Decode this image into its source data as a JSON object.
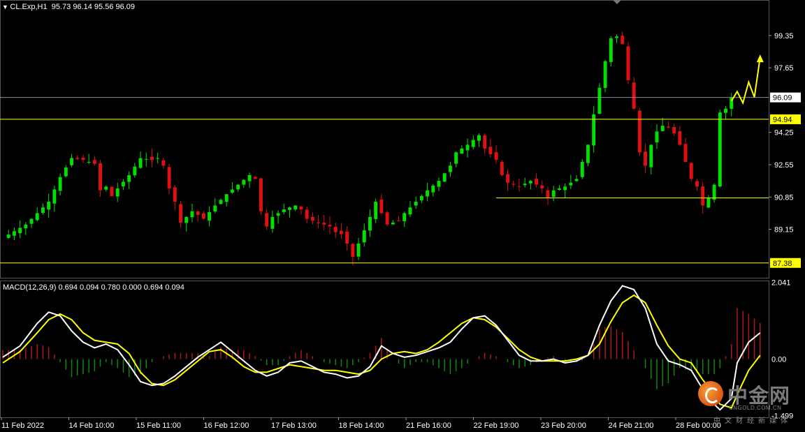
{
  "header": {
    "symbol": "CL.Exp,H1",
    "ohlc": "95.73 96.14 95.56 96.09",
    "macd_label": "MACD(12,26,9) 0.694 0.094 0.780 0.000 0.694 0.094"
  },
  "colors": {
    "background": "#000000",
    "bull": "#00e000",
    "bear": "#e01010",
    "level_line": "#ffff00",
    "bid_line": "#8a8ea8",
    "macd_line": "#ffffff",
    "signal_line": "#ffff00",
    "axis_text": "#ffffff"
  },
  "chart_data": [
    {
      "type": "candlestick",
      "title": "CL.Exp,H1",
      "y_ticks": [
        "99.35",
        "97.65",
        "94.25",
        "92.55",
        "90.85",
        "89.15"
      ],
      "ylim": [
        86.6,
        100.85
      ],
      "x_ticks": [
        "11 Feb 2022",
        "14 Feb 10:00",
        "15 Feb 11:00",
        "16 Feb 12:00",
        "17 Feb 13:00",
        "18 Feb 14:00",
        "21 Feb 16:00",
        "22 Feb 19:00",
        "23 Feb 20:00",
        "24 Feb 21:00",
        "28 Feb 00:00"
      ],
      "levels": [
        {
          "label": "96.09",
          "value": 96.09,
          "kind": "bid"
        },
        {
          "label": "94.94",
          "value": 94.94,
          "kind": "horizontal"
        },
        {
          "label": "87.38",
          "value": 87.38,
          "kind": "horizontal"
        }
      ],
      "support_segment": {
        "value": 90.8
      },
      "close_path": [
        [
          0,
          88.7
        ],
        [
          4,
          89.4
        ],
        [
          8,
          90.6
        ],
        [
          10,
          91.9
        ],
        [
          12,
          92.9
        ],
        [
          14,
          92.8
        ],
        [
          16,
          92.6
        ],
        [
          17,
          91.2
        ],
        [
          18,
          91.4
        ],
        [
          19,
          90.9
        ],
        [
          20,
          91.3
        ],
        [
          22,
          92.0
        ],
        [
          24,
          92.9
        ],
        [
          26,
          92.8
        ],
        [
          27,
          92.9
        ],
        [
          28,
          92.5
        ],
        [
          29,
          91.3
        ],
        [
          30,
          90.6
        ],
        [
          31,
          89.5
        ],
        [
          32,
          89.8
        ],
        [
          33,
          90.1
        ],
        [
          35,
          89.7
        ],
        [
          37,
          90.4
        ],
        [
          39,
          91.0
        ],
        [
          41,
          91.5
        ],
        [
          43,
          92.0
        ],
        [
          44,
          91.8
        ],
        [
          45,
          90.1
        ],
        [
          46,
          89.3
        ],
        [
          47,
          89.8
        ],
        [
          49,
          90.2
        ],
        [
          51,
          90.4
        ],
        [
          52,
          90.2
        ],
        [
          53,
          89.7
        ],
        [
          55,
          89.5
        ],
        [
          57,
          89.3
        ],
        [
          58,
          89.0
        ],
        [
          59,
          88.9
        ],
        [
          60,
          88.4
        ],
        [
          61,
          87.7
        ],
        [
          62,
          88.4
        ],
        [
          63,
          89.1
        ],
        [
          64,
          89.8
        ],
        [
          65,
          90.6
        ],
        [
          66,
          90.0
        ],
        [
          67,
          89.4
        ],
        [
          69,
          89.6
        ],
        [
          70,
          90.0
        ],
        [
          72,
          90.6
        ],
        [
          74,
          91.2
        ],
        [
          76,
          91.7
        ],
        [
          78,
          92.5
        ],
        [
          79,
          93.2
        ],
        [
          81,
          93.6
        ],
        [
          83,
          94.1
        ],
        [
          84,
          93.4
        ],
        [
          86,
          92.8
        ],
        [
          87,
          92.0
        ],
        [
          88,
          91.6
        ],
        [
          90,
          91.4
        ],
        [
          92,
          91.7
        ],
        [
          94,
          91.3
        ],
        [
          95,
          90.8
        ],
        [
          96,
          91.2
        ],
        [
          98,
          91.4
        ],
        [
          100,
          91.8
        ],
        [
          101,
          92.7
        ],
        [
          102,
          93.6
        ],
        [
          103,
          95.2
        ],
        [
          104,
          96.6
        ],
        [
          105,
          98.0
        ],
        [
          106,
          99.2
        ],
        [
          107,
          99.3
        ],
        [
          108,
          98.9
        ],
        [
          109,
          97.0
        ],
        [
          110,
          95.5
        ],
        [
          111,
          93.2
        ],
        [
          112,
          92.5
        ],
        [
          113,
          93.6
        ],
        [
          114,
          94.3
        ],
        [
          115,
          94.6
        ],
        [
          116,
          94.5
        ],
        [
          117,
          94.2
        ],
        [
          118,
          93.6
        ],
        [
          119,
          92.7
        ],
        [
          120,
          91.8
        ],
        [
          121,
          91.4
        ],
        [
          122,
          90.4
        ],
        [
          123,
          90.8
        ],
        [
          124,
          91.5
        ],
        [
          125,
          95.3
        ],
        [
          126,
          95.5
        ],
        [
          127,
          96.09
        ]
      ],
      "projection_arrow": [
        [
          127,
          95.9
        ],
        [
          128,
          96.4
        ],
        [
          129,
          95.8
        ],
        [
          130,
          96.9
        ],
        [
          131,
          96.1
        ],
        [
          132,
          98.2
        ]
      ]
    },
    {
      "type": "line",
      "title": "MACD(12,26,9) 0.694 0.094 0.780 0.000 0.694 0.094",
      "y_ticks": [
        "2.041",
        "0.00",
        "-1.499"
      ],
      "ylim": [
        -1.55,
        2.09
      ],
      "series": [
        {
          "name": "MACD",
          "points": [
            [
              0,
              0.05
            ],
            [
              3,
              0.35
            ],
            [
              6,
              0.95
            ],
            [
              8,
              1.25
            ],
            [
              10,
              1.15
            ],
            [
              12,
              0.75
            ],
            [
              14,
              0.45
            ],
            [
              16,
              0.3
            ],
            [
              18,
              0.4
            ],
            [
              20,
              0.25
            ],
            [
              22,
              -0.15
            ],
            [
              24,
              -0.6
            ],
            [
              26,
              -0.7
            ],
            [
              28,
              -0.65
            ],
            [
              30,
              -0.45
            ],
            [
              32,
              -0.2
            ],
            [
              34,
              0.05
            ],
            [
              36,
              0.25
            ],
            [
              38,
              0.45
            ],
            [
              40,
              0.2
            ],
            [
              42,
              -0.05
            ],
            [
              44,
              -0.3
            ],
            [
              46,
              -0.45
            ],
            [
              48,
              -0.35
            ],
            [
              50,
              -0.1
            ],
            [
              52,
              -0.05
            ],
            [
              54,
              -0.2
            ],
            [
              56,
              -0.35
            ],
            [
              58,
              -0.4
            ],
            [
              60,
              -0.5
            ],
            [
              62,
              -0.45
            ],
            [
              64,
              -0.2
            ],
            [
              66,
              0.35
            ],
            [
              68,
              0.15
            ],
            [
              70,
              0.05
            ],
            [
              72,
              0.1
            ],
            [
              74,
              0.2
            ],
            [
              76,
              0.3
            ],
            [
              78,
              0.45
            ],
            [
              80,
              0.8
            ],
            [
              82,
              1.1
            ],
            [
              84,
              1.15
            ],
            [
              86,
              0.9
            ],
            [
              88,
              0.5
            ],
            [
              90,
              0.1
            ],
            [
              92,
              -0.05
            ],
            [
              94,
              -0.05
            ],
            [
              96,
              0.0
            ],
            [
              98,
              -0.1
            ],
            [
              100,
              -0.05
            ],
            [
              102,
              0.1
            ],
            [
              104,
              0.9
            ],
            [
              106,
              1.55
            ],
            [
              108,
              1.95
            ],
            [
              110,
              1.85
            ],
            [
              112,
              1.35
            ],
            [
              114,
              0.4
            ],
            [
              116,
              -0.05
            ],
            [
              118,
              -0.15
            ],
            [
              120,
              -0.3
            ],
            [
              122,
              -0.8
            ],
            [
              124,
              -1.2
            ],
            [
              125,
              -1.35
            ],
            [
              127,
              -1.05
            ],
            [
              128,
              -0.1
            ],
            [
              130,
              0.45
            ],
            [
              132,
              0.7
            ]
          ]
        },
        {
          "name": "Signal",
          "points": [
            [
              0,
              -0.1
            ],
            [
              3,
              0.2
            ],
            [
              6,
              0.7
            ],
            [
              8,
              1.05
            ],
            [
              10,
              1.2
            ],
            [
              12,
              1.05
            ],
            [
              14,
              0.7
            ],
            [
              16,
              0.5
            ],
            [
              18,
              0.45
            ],
            [
              20,
              0.4
            ],
            [
              22,
              0.15
            ],
            [
              24,
              -0.35
            ],
            [
              26,
              -0.65
            ],
            [
              28,
              -0.7
            ],
            [
              30,
              -0.55
            ],
            [
              32,
              -0.3
            ],
            [
              34,
              -0.05
            ],
            [
              36,
              0.2
            ],
            [
              38,
              0.25
            ],
            [
              40,
              0.05
            ],
            [
              42,
              -0.2
            ],
            [
              44,
              -0.35
            ],
            [
              46,
              -0.35
            ],
            [
              48,
              -0.25
            ],
            [
              50,
              -0.15
            ],
            [
              52,
              -0.2
            ],
            [
              54,
              -0.25
            ],
            [
              56,
              -0.3
            ],
            [
              58,
              -0.3
            ],
            [
              60,
              -0.35
            ],
            [
              62,
              -0.4
            ],
            [
              64,
              -0.3
            ],
            [
              66,
              0.0
            ],
            [
              68,
              0.15
            ],
            [
              70,
              0.2
            ],
            [
              72,
              0.15
            ],
            [
              74,
              0.25
            ],
            [
              76,
              0.45
            ],
            [
              78,
              0.7
            ],
            [
              80,
              0.95
            ],
            [
              82,
              1.1
            ],
            [
              84,
              1.05
            ],
            [
              86,
              0.85
            ],
            [
              88,
              0.55
            ],
            [
              90,
              0.25
            ],
            [
              92,
              0.05
            ],
            [
              94,
              -0.05
            ],
            [
              96,
              -0.05
            ],
            [
              98,
              -0.05
            ],
            [
              100,
              0.0
            ],
            [
              102,
              0.1
            ],
            [
              104,
              0.4
            ],
            [
              106,
              1.0
            ],
            [
              108,
              1.5
            ],
            [
              110,
              1.7
            ],
            [
              112,
              1.5
            ],
            [
              114,
              0.9
            ],
            [
              116,
              0.35
            ],
            [
              118,
              0.0
            ],
            [
              120,
              -0.1
            ],
            [
              122,
              -0.55
            ],
            [
              124,
              -0.95
            ],
            [
              125,
              -1.2
            ],
            [
              127,
              -1.3
            ],
            [
              128,
              -0.95
            ],
            [
              130,
              -0.3
            ],
            [
              132,
              0.1
            ]
          ]
        }
      ],
      "histogram": "MACD"
    }
  ],
  "watermark": {
    "cn": "中金网",
    "en": "CNGOLD.COM.CN",
    "sub": "中文财经新媒体"
  }
}
